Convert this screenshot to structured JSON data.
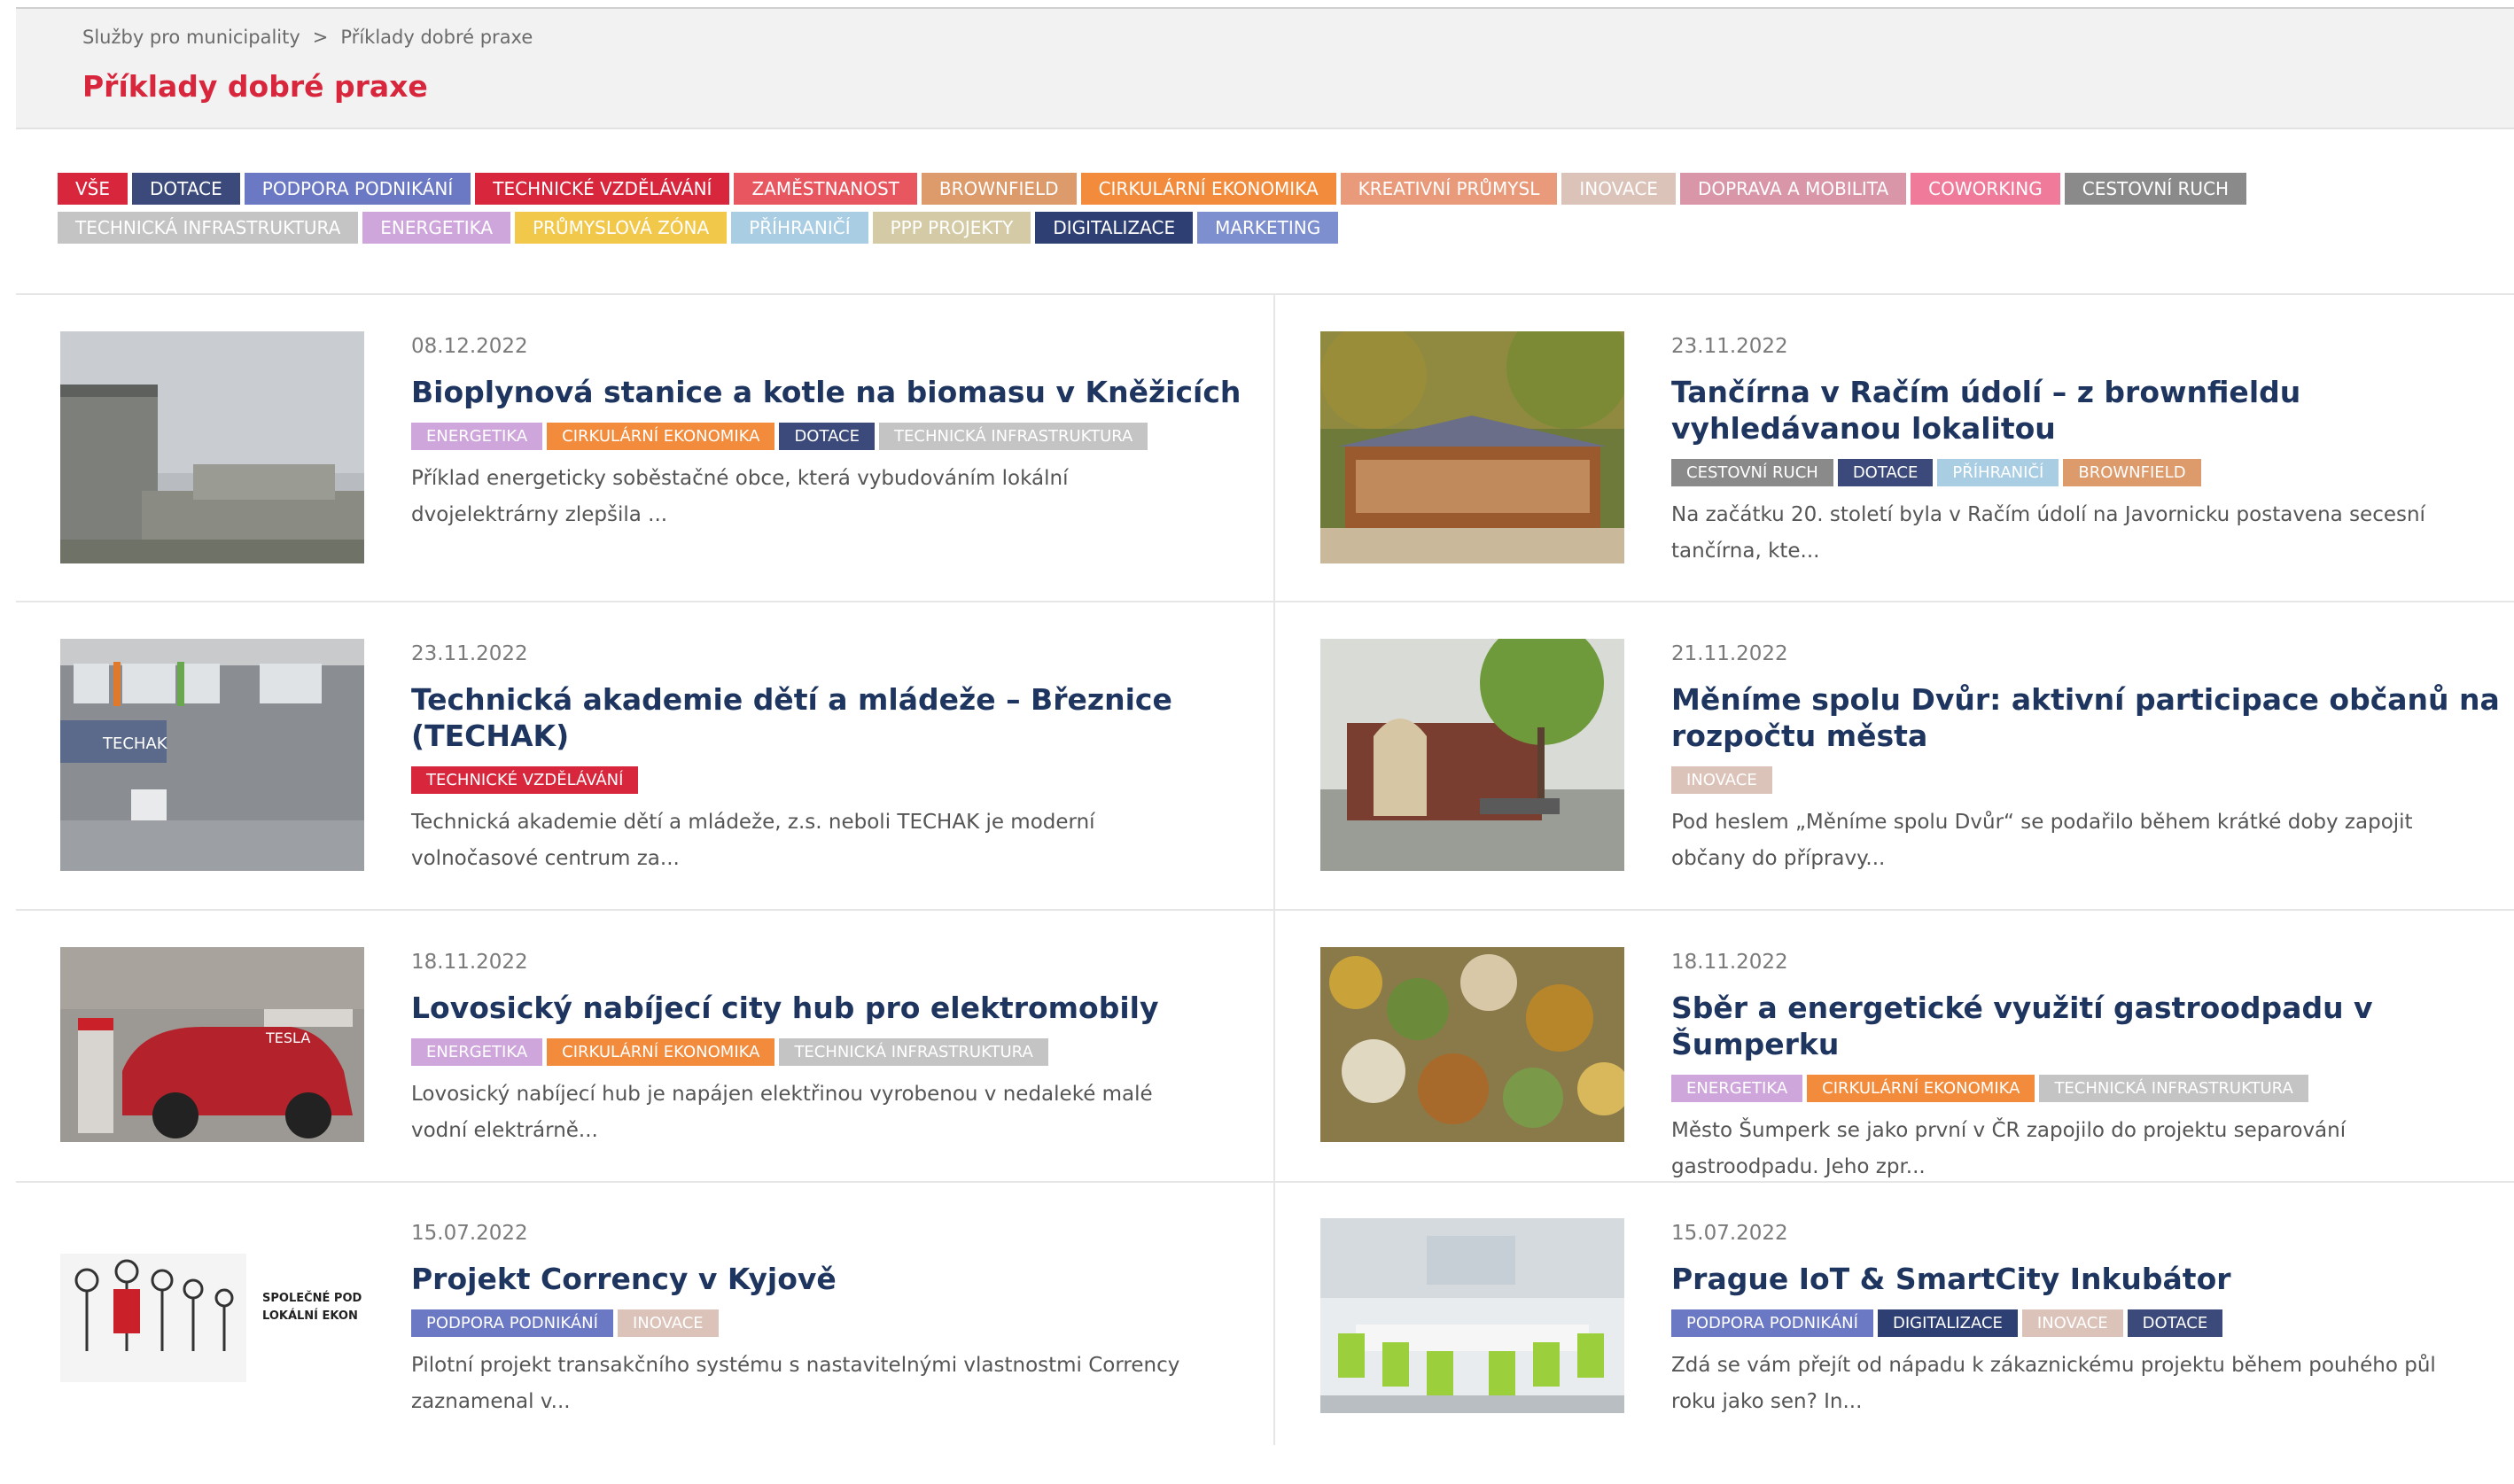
{
  "breadcrumb": {
    "parent": "Služby pro municipality",
    "separator": ">",
    "current": "Příklady dobré praxe"
  },
  "page_title": "Příklady dobré praxe",
  "colors": {
    "vse": "#d8263d",
    "dotace": "#3b4a7a",
    "podpora": "#6b79c4",
    "technicke": "#d8263d",
    "zamestnanost": "#e8575f",
    "brownfield": "#dd9a6b",
    "cirkularni": "#f28b3c",
    "kreativni": "#e89a7a",
    "inovace": "#dcc3b9",
    "doprava": "#d996a8",
    "coworking": "#f07a9a",
    "cestovni": "#8a8a8a",
    "infrastruktura": "#c4c4c4",
    "energetika": "#cfa6dc",
    "prumyslova": "#f2c84b",
    "prihranici": "#a9cde3",
    "ppp": "#d4cba6",
    "digitalizace": "#2e3f74",
    "marketing": "#7e8fd0"
  },
  "filters": {
    "row1": [
      {
        "label": "Vše",
        "c": "vse"
      },
      {
        "label": "Dotace",
        "c": "dotace"
      },
      {
        "label": "Podpora podnikání",
        "c": "podpora"
      },
      {
        "label": "Technické vzdělávání",
        "c": "technicke"
      },
      {
        "label": "Zaměstnanost",
        "c": "zamestnanost"
      },
      {
        "label": "Brownfield",
        "c": "brownfield"
      },
      {
        "label": "Cirkulární ekonomika",
        "c": "cirkularni"
      },
      {
        "label": "Kreativní průmysl",
        "c": "kreativni"
      },
      {
        "label": "Inovace",
        "c": "inovace"
      },
      {
        "label": "Doprava a mobilita",
        "c": "doprava"
      },
      {
        "label": "Coworking",
        "c": "coworking"
      },
      {
        "label": "Cestovní ruch",
        "c": "cestovni"
      }
    ],
    "row2": [
      {
        "label": "Technická infrastruktura",
        "c": "infrastruktura"
      },
      {
        "label": "Energetika",
        "c": "energetika"
      },
      {
        "label": "Průmyslová zóna",
        "c": "prumyslova"
      },
      {
        "label": "Příhraničí",
        "c": "prihranici"
      },
      {
        "label": "PPP projekty",
        "c": "ppp"
      },
      {
        "label": "Digitalizace",
        "c": "digitalizace"
      },
      {
        "label": "Marketing",
        "c": "marketing"
      }
    ]
  },
  "articles": [
    {
      "date": "08.12.2022",
      "title": "Bioplynová stanice a kotle na biomasu v Kněžicích",
      "tags": [
        {
          "label": "Energetika",
          "c": "energetika"
        },
        {
          "label": "Cirkulární ekonomika",
          "c": "cirkularni"
        },
        {
          "label": "Dotace",
          "c": "dotace"
        },
        {
          "label": "Technická infrastruktura",
          "c": "infrastruktura"
        }
      ],
      "excerpt": "Příklad energeticky soběstačné obce, která vybudováním lokální dvojelektrárny zlepšila ..."
    },
    {
      "date": "23.11.2022",
      "title": "Tančírna v Račím údolí – z brownfieldu vyhledávanou lokalitou",
      "tags": [
        {
          "label": "Cestovní ruch",
          "c": "cestovni"
        },
        {
          "label": "Dotace",
          "c": "dotace"
        },
        {
          "label": "Příhraničí",
          "c": "prihranici"
        },
        {
          "label": "Brownfield",
          "c": "brownfield"
        }
      ],
      "excerpt": "Na začátku 20. století byla v Račím údolí na Javornicku postavena secesní tančírna, kte..."
    },
    {
      "date": "23.11.2022",
      "title": "Technická akademie dětí a mládeže – Březnice (TECHAK)",
      "tags": [
        {
          "label": "Technické vzdělávání",
          "c": "technicke"
        }
      ],
      "excerpt": "Technická akademie dětí a mládeže, z.s. neboli TECHAK je moderní volnočasové centrum za...",
      "image_text": "TECHAK"
    },
    {
      "date": "21.11.2022",
      "title": "Měníme spolu Dvůr: aktivní participace občanů na rozpočtu města",
      "tags": [
        {
          "label": "Inovace",
          "c": "inovace"
        }
      ],
      "excerpt": "Pod heslem „Měníme spolu Dvůr“ se podařilo během krátké doby zapojit občany do přípravy..."
    },
    {
      "date": "18.11.2022",
      "title": "Lovosický nabíjecí city hub pro elektromobily",
      "tags": [
        {
          "label": "Energetika",
          "c": "energetika"
        },
        {
          "label": "Cirkulární ekonomika",
          "c": "cirkularni"
        },
        {
          "label": "Technická infrastruktura",
          "c": "infrastruktura"
        }
      ],
      "excerpt": "Lovosický nabíjecí hub je napájen elektřinou vyrobenou v nedaleké malé vodní elektrárně...",
      "image_text": "TESLA"
    },
    {
      "date": "18.11.2022",
      "title": "Sběr a energetické využití gastroodpadu v Šumperku",
      "tags": [
        {
          "label": "Energetika",
          "c": "energetika"
        },
        {
          "label": "Cirkulární ekonomika",
          "c": "cirkularni"
        },
        {
          "label": "Technická infrastruktura",
          "c": "infrastruktura"
        }
      ],
      "excerpt": "Město Šumperk se jako první v ČR zapojilo do projektu separování gastroodpadu. Jeho zpr..."
    },
    {
      "date": "15.07.2022",
      "title": "Projekt Correncу v Kyjově",
      "tags": [
        {
          "label": "Podpora podnikání",
          "c": "podpora"
        },
        {
          "label": "Inovace",
          "c": "inovace"
        }
      ],
      "excerpt": "Pilotní projekt transakčního systému s nastavitelnými vlastnostmi Correncу zaznamenal v...",
      "image_text": [
        "SPOLEČNÉ POD",
        "LOKÁLNÍ EKON"
      ]
    },
    {
      "date": "15.07.2022",
      "title": "Prague IoT & SmartCity Inkubátor",
      "tags": [
        {
          "label": "Podpora podnikání",
          "c": "podpora"
        },
        {
          "label": "Digitalizace",
          "c": "digitalizace"
        },
        {
          "label": "Inovace",
          "c": "inovace"
        },
        {
          "label": "Dotace",
          "c": "dotace"
        }
      ],
      "excerpt": "Zdá se vám přejít od nápadu k zákaznickému projektu během pouhého půl roku jako sen? In..."
    }
  ]
}
